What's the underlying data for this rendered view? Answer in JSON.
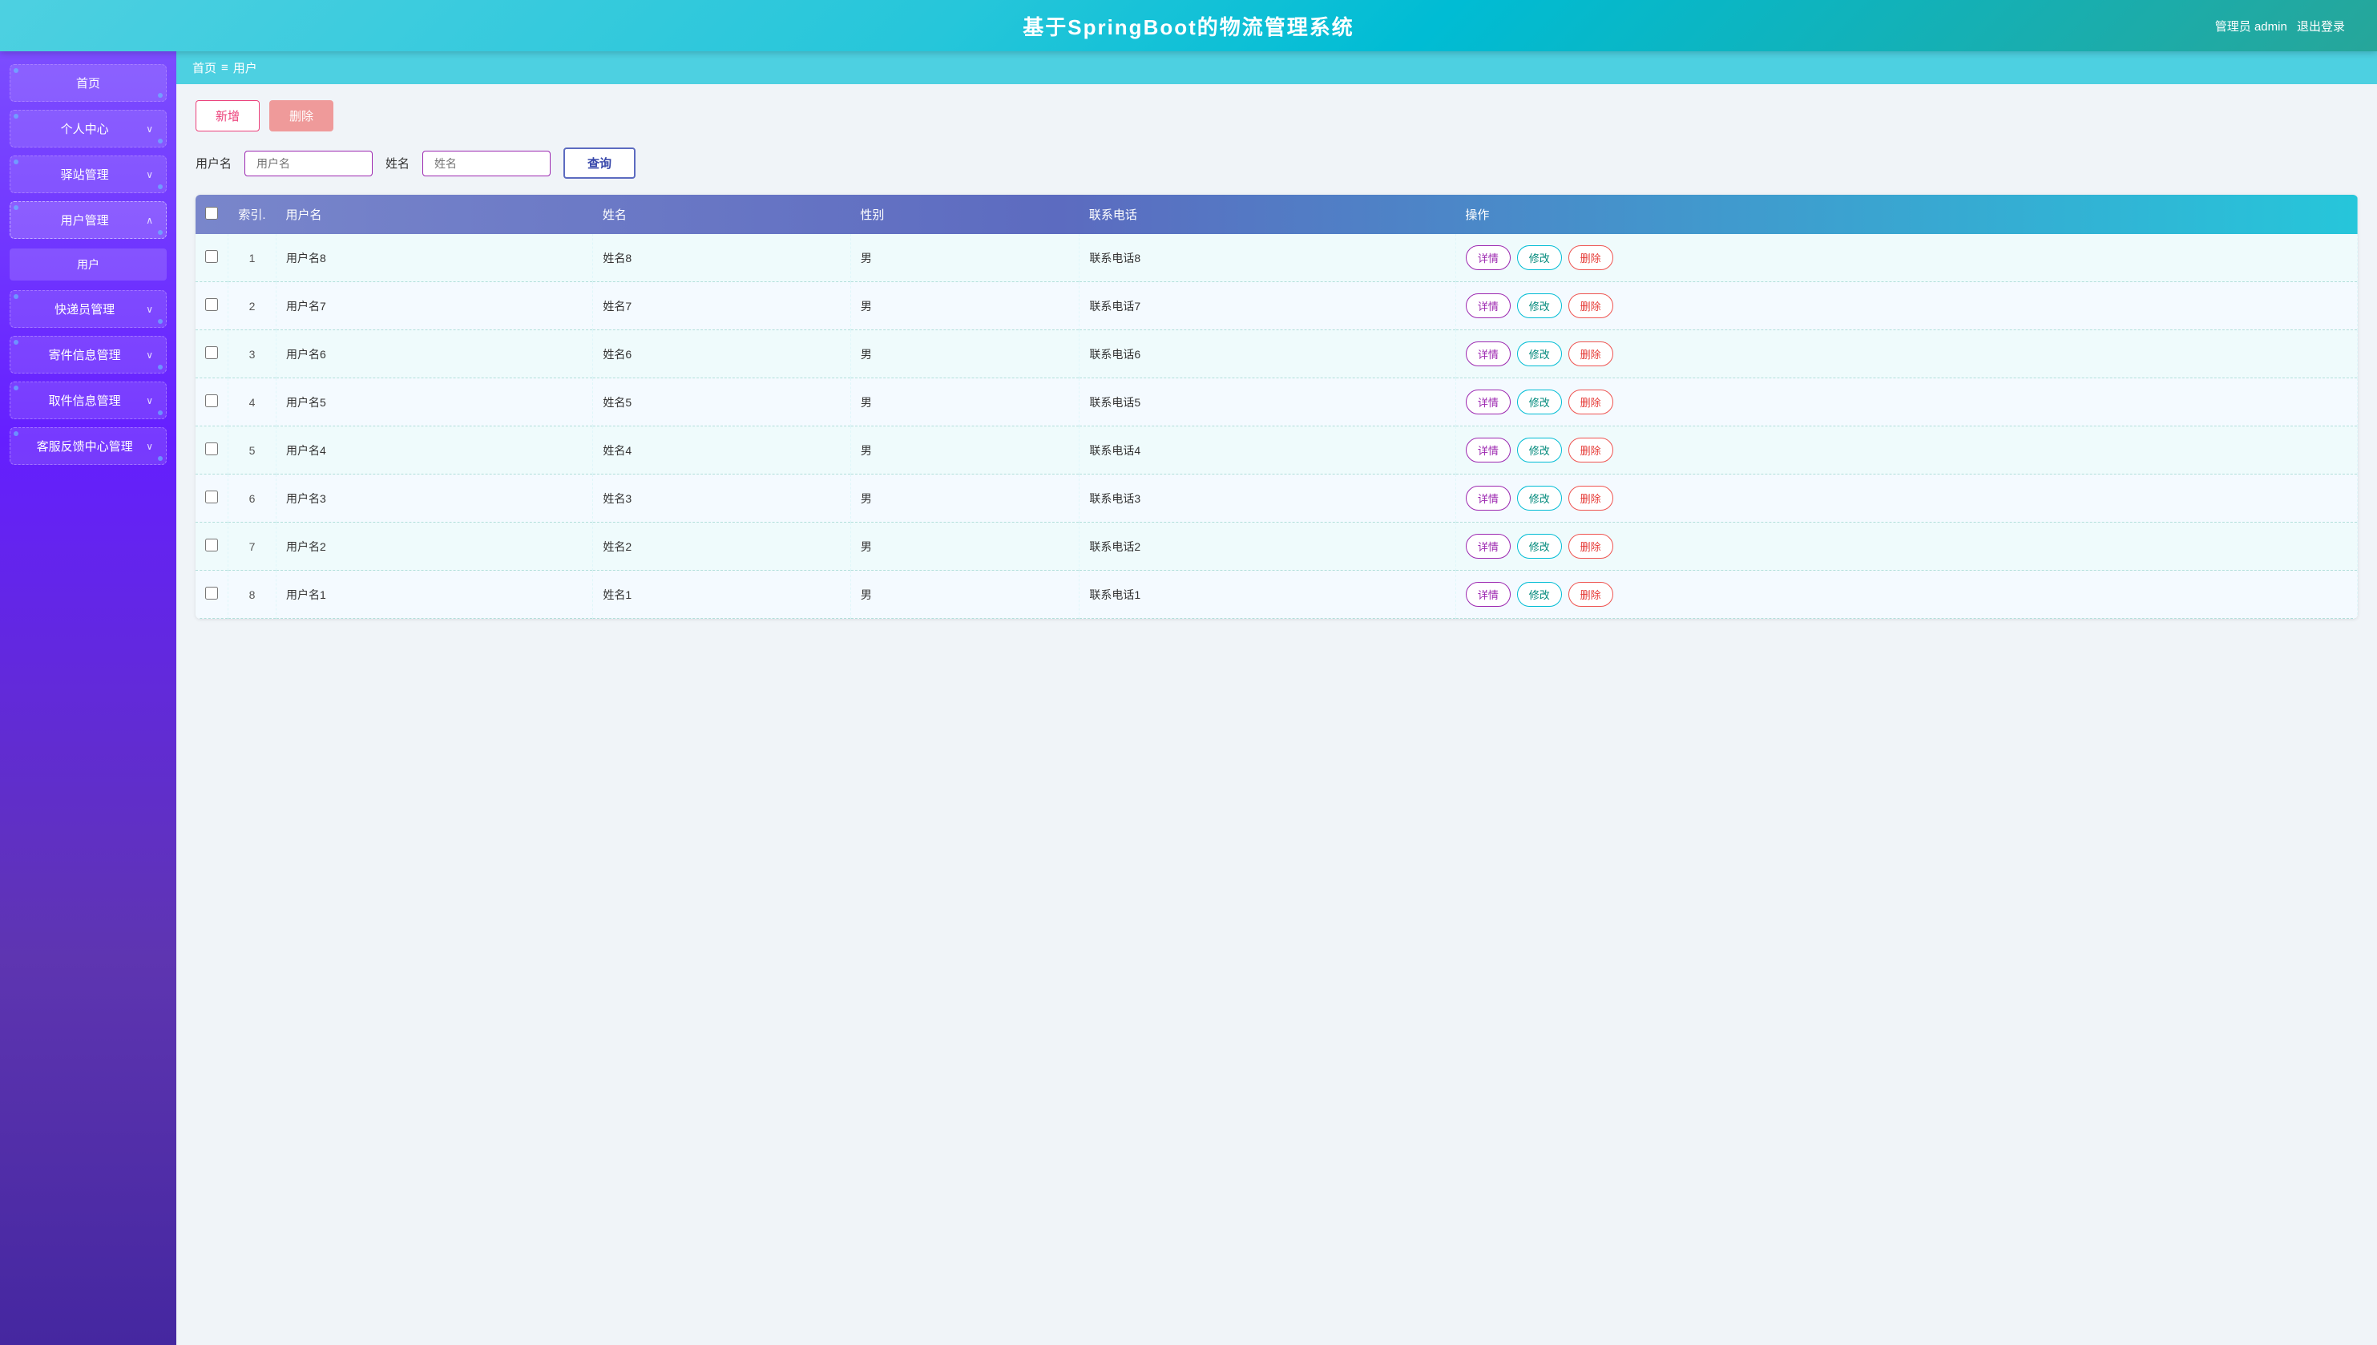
{
  "header": {
    "title": "基于SpringBoot的物流管理系统",
    "user_info": "管理员 admin",
    "logout_label": "退出登录"
  },
  "sidebar": {
    "items": [
      {
        "id": "home",
        "label": "首页",
        "has_arrow": false,
        "expanded": false
      },
      {
        "id": "personal",
        "label": "个人中心",
        "has_arrow": true,
        "expanded": false
      },
      {
        "id": "station",
        "label": "驿站管理",
        "has_arrow": true,
        "expanded": false
      },
      {
        "id": "user-mgmt",
        "label": "用户管理",
        "has_arrow": true,
        "expanded": true
      },
      {
        "id": "courier",
        "label": "快递员管理",
        "has_arrow": true,
        "expanded": false
      },
      {
        "id": "package-info",
        "label": "寄件信息管理",
        "has_arrow": true,
        "expanded": false
      },
      {
        "id": "pickup-info",
        "label": "取件信息管理",
        "has_arrow": true,
        "expanded": false
      },
      {
        "id": "feedback",
        "label": "客服反馈中心管理",
        "has_arrow": true,
        "expanded": false
      }
    ],
    "sub_items": {
      "user-mgmt": [
        {
          "id": "user",
          "label": "用户"
        }
      ]
    }
  },
  "breadcrumb": {
    "home": "首页",
    "separator": "≡",
    "current": "用户"
  },
  "toolbar": {
    "add_label": "新增",
    "delete_label": "删除"
  },
  "search": {
    "username_label": "用户名",
    "username_placeholder": "用户名",
    "name_label": "姓名",
    "name_placeholder": "姓名",
    "search_button": "查询"
  },
  "table": {
    "columns": [
      {
        "id": "checkbox",
        "label": ""
      },
      {
        "id": "index",
        "label": "索引."
      },
      {
        "id": "username",
        "label": "用户名"
      },
      {
        "id": "name",
        "label": "姓名"
      },
      {
        "id": "gender",
        "label": "性别"
      },
      {
        "id": "phone",
        "label": "联系电话"
      },
      {
        "id": "action",
        "label": "操作"
      }
    ],
    "rows": [
      {
        "index": 1,
        "username": "用户名8",
        "name": "姓名8",
        "gender": "男",
        "phone": "联系电话8"
      },
      {
        "index": 2,
        "username": "用户名7",
        "name": "姓名7",
        "gender": "男",
        "phone": "联系电话7"
      },
      {
        "index": 3,
        "username": "用户名6",
        "name": "姓名6",
        "gender": "男",
        "phone": "联系电话6"
      },
      {
        "index": 4,
        "username": "用户名5",
        "name": "姓名5",
        "gender": "男",
        "phone": "联系电话5"
      },
      {
        "index": 5,
        "username": "用户名4",
        "name": "姓名4",
        "gender": "男",
        "phone": "联系电话4"
      },
      {
        "index": 6,
        "username": "用户名3",
        "name": "姓名3",
        "gender": "男",
        "phone": "联系电话3"
      },
      {
        "index": 7,
        "username": "用户名2",
        "name": "姓名2",
        "gender": "男",
        "phone": "联系电话2"
      },
      {
        "index": 8,
        "username": "用户名1",
        "name": "姓名1",
        "gender": "男",
        "phone": "联系电话1"
      }
    ],
    "actions": {
      "detail": "详情",
      "edit": "修改",
      "delete": "删除"
    }
  }
}
